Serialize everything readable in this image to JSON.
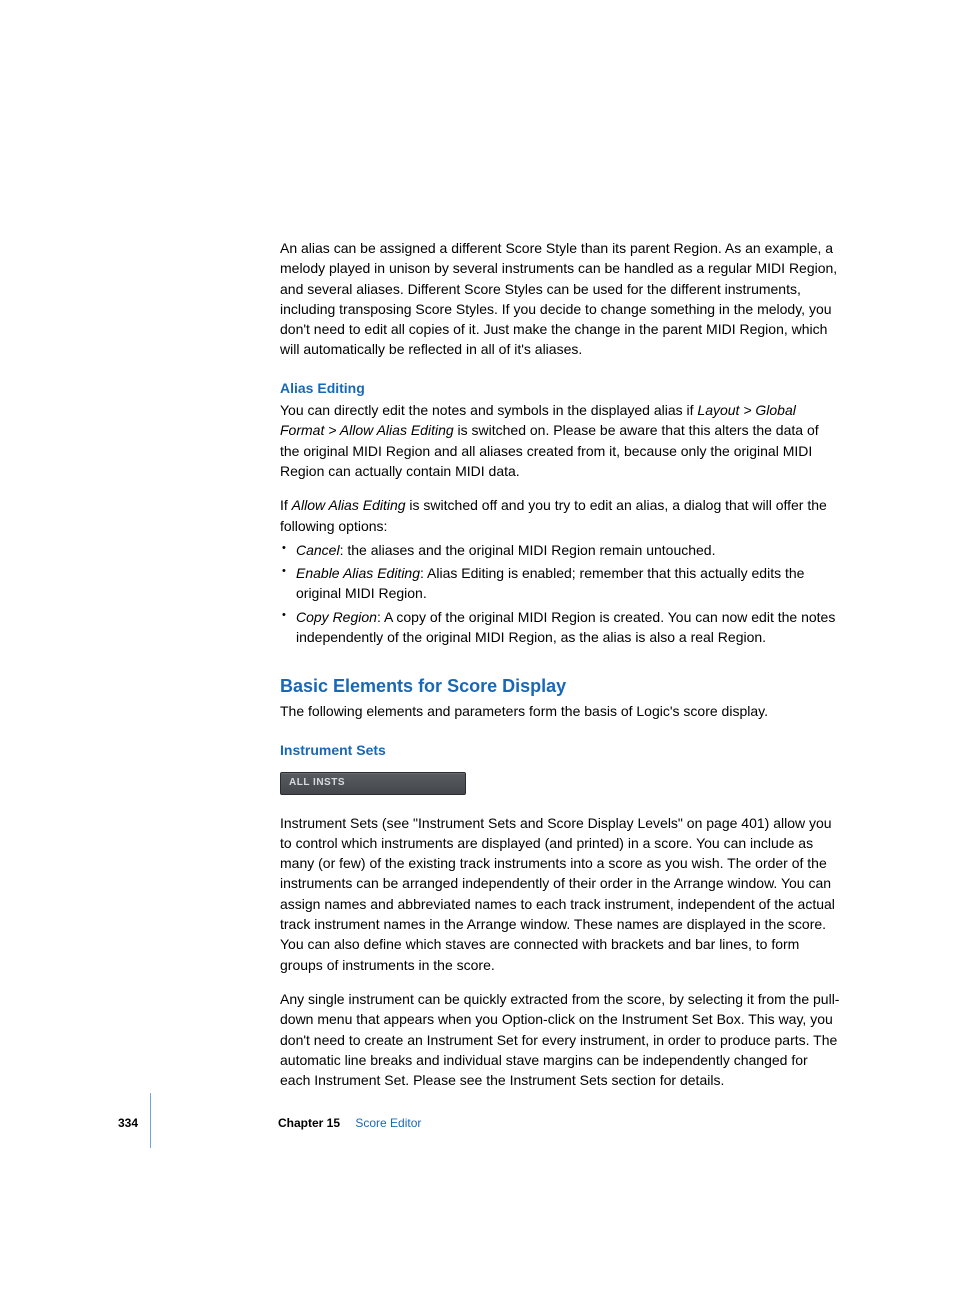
{
  "intro_para": "An alias can be assigned a different Score Style than its parent Region. As an example, a melody played in unison by several instruments can be handled as a regular MIDI Region, and several aliases. Different Score Styles can be used for the different instruments, including transposing Score Styles. If you decide to change something in the melody, you don't need to edit all copies of it. Just make the change in the parent MIDI Region, which will automatically be reflected in all of it's aliases.",
  "alias_editing_head": "Alias Editing",
  "alias_editing_p1_pre": "You can directly edit the notes and symbols in the displayed alias if ",
  "alias_editing_p1_italic": "Layout > Global Format > Allow Alias Editing",
  "alias_editing_p1_post": " is switched on. Please be aware that this alters the data of the original MIDI Region and all aliases created from it, because only the original MIDI Region can actually contain MIDI data.",
  "alias_editing_p2_pre": "If ",
  "alias_editing_p2_italic": "Allow Alias Editing",
  "alias_editing_p2_post": " is switched off and you try to edit an alias, a dialog that will offer the following options:",
  "bullet1_term": "Cancel",
  "bullet1_text": ":  the aliases and the original MIDI Region remain untouched.",
  "bullet2_term": "Enable Alias Editing",
  "bullet2_text": ":  Alias Editing is enabled; remember that this actually edits the original MIDI Region.",
  "bullet3_term": "Copy Region",
  "bullet3_text": ":  A copy of the original MIDI Region is created. You can now edit the notes independently of the original MIDI Region, as the alias is also a real Region.",
  "basic_head": "Basic Elements for Score Display",
  "basic_sub": "The following elements and parameters form the basis of Logic's score display.",
  "instrument_sets_head": "Instrument Sets",
  "ui_box": "ALL INSTS",
  "inst_p1": "Instrument Sets (see \"Instrument Sets and Score Display Levels\" on page 401) allow you to control which instruments are displayed (and printed) in a score. You can include as many (or few) of the existing track instruments into a score as you wish. The order of the instruments can be arranged independently of their order in the Arrange window. You can assign names and abbreviated names to each track instrument, independent of the actual track instrument names in the Arrange window. These names are displayed in the score. You can also define which staves are connected with brackets and bar lines, to form groups of instruments in the score.",
  "inst_p2": "Any single instrument can be quickly extracted from the score, by selecting it from the pull-down menu that appears when you Option-click on the Instrument Set Box. This way, you don't need to create an Instrument Set for every instrument, in order to produce parts. The automatic line breaks and individual stave margins can be independently changed for each Instrument Set. Please see the Instrument Sets section for details.",
  "footer_page": "334",
  "footer_chapter": "Chapter 15",
  "footer_title": "Score Editor"
}
